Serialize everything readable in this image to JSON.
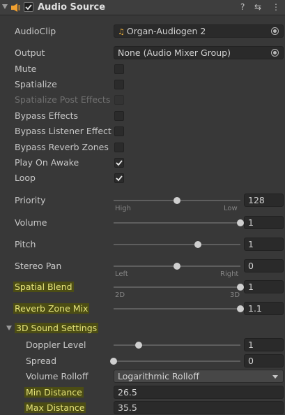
{
  "component": {
    "title": "Audio Source",
    "enabled": true,
    "header_icons": {
      "help": "?",
      "presets": "⇆",
      "menu": "⋮"
    }
  },
  "fields": {
    "audio_clip": {
      "label": "AudioClip",
      "value": "Organ-Audiogen 2",
      "icon": "music-note-icon"
    },
    "output": {
      "label": "Output",
      "value": "None (Audio Mixer Group)"
    }
  },
  "toggles": [
    {
      "label": "Mute",
      "checked": false
    },
    {
      "label": "Spatialize",
      "checked": false
    },
    {
      "label": "Spatialize Post Effects",
      "checked": false,
      "disabled": true
    },
    {
      "label": "Bypass Effects",
      "checked": false
    },
    {
      "label": "Bypass Listener Effect",
      "checked": false
    },
    {
      "label": "Bypass Reverb Zones",
      "checked": false
    },
    {
      "label": "Play On Awake",
      "checked": true
    },
    {
      "label": "Loop",
      "checked": true
    }
  ],
  "sliders": {
    "priority": {
      "label": "Priority",
      "value": "128",
      "fraction": 0.5,
      "min_caption": "High",
      "max_caption": "Low"
    },
    "volume": {
      "label": "Volume",
      "value": "1",
      "fraction": 1.0
    },
    "pitch": {
      "label": "Pitch",
      "value": "1",
      "fraction": 0.667
    },
    "stereo_pan": {
      "label": "Stereo Pan",
      "value": "0",
      "fraction": 0.5,
      "min_caption": "Left",
      "max_caption": "Right"
    },
    "spatial_blend": {
      "label": "Spatial Blend",
      "value": "1",
      "fraction": 1.0,
      "min_caption": "2D",
      "max_caption": "3D"
    },
    "reverb_zone_mix": {
      "label": "Reverb Zone Mix",
      "value": "1.1",
      "fraction": 1.0
    }
  },
  "sound3d": {
    "section_label": "3D Sound Settings",
    "doppler": {
      "label": "Doppler Level",
      "value": "1",
      "fraction": 0.2
    },
    "spread": {
      "label": "Spread",
      "value": "0",
      "fraction": 0.0
    },
    "rolloff": {
      "label": "Volume Rolloff",
      "value": "Logarithmic Rolloff"
    },
    "min_distance": {
      "label": "Min Distance",
      "value": "26.5"
    },
    "max_distance": {
      "label": "Max Distance",
      "value": "35.5"
    }
  },
  "colors": {
    "highlight": "#4c4d14",
    "highlight_text": "#e6e47a",
    "speaker_orange": "#f0a030",
    "background": "#383838"
  }
}
